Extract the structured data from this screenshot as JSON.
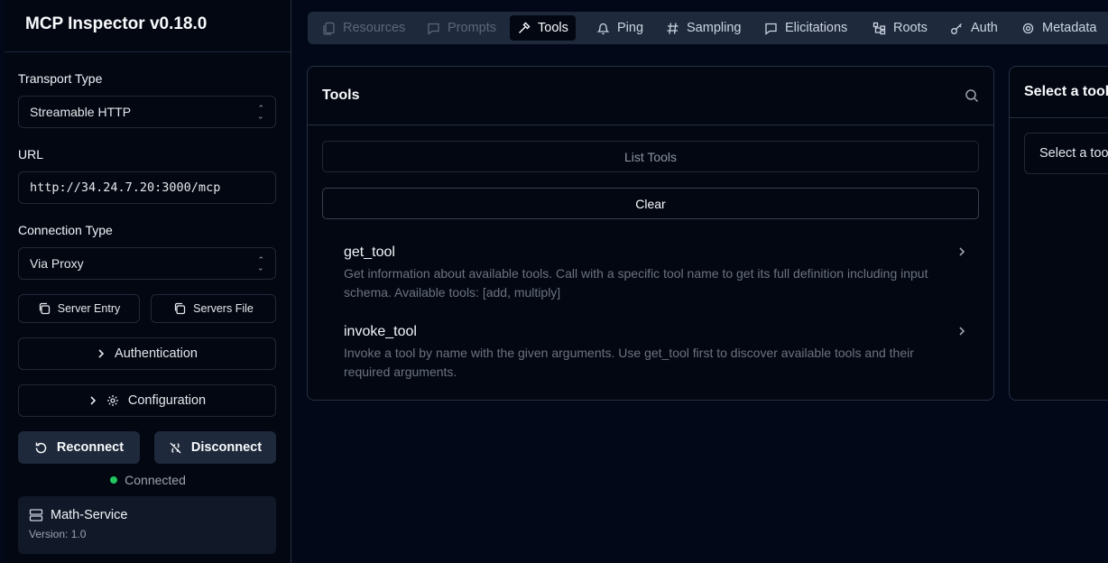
{
  "app": {
    "title": "MCP Inspector v0.18.0"
  },
  "sidebar": {
    "transport_label": "Transport Type",
    "transport_value": "Streamable HTTP",
    "url_label": "URL",
    "url_value": "http://34.24.7.20:3000/mcp",
    "connection_label": "Connection Type",
    "connection_value": "Via Proxy",
    "server_entry_label": "Server Entry",
    "servers_file_label": "Servers File",
    "authentication_label": "Authentication",
    "configuration_label": "Configuration",
    "reconnect_label": "Reconnect",
    "disconnect_label": "Disconnect",
    "status_text": "Connected",
    "server": {
      "name": "Math-Service",
      "version": "Version: 1.0"
    }
  },
  "tabs": [
    {
      "label": "Resources",
      "icon": "files-icon",
      "state": "disabled"
    },
    {
      "label": "Prompts",
      "icon": "message-icon",
      "state": "disabled"
    },
    {
      "label": "Tools",
      "icon": "hammer-icon",
      "state": "active"
    },
    {
      "label": "Ping",
      "icon": "bell-icon",
      "state": "normal"
    },
    {
      "label": "Sampling",
      "icon": "hash-icon",
      "state": "normal"
    },
    {
      "label": "Elicitations",
      "icon": "message-icon",
      "state": "normal"
    },
    {
      "label": "Roots",
      "icon": "folder-tree-icon",
      "state": "normal"
    },
    {
      "label": "Auth",
      "icon": "key-icon",
      "state": "normal"
    },
    {
      "label": "Metadata",
      "icon": "gear-icon",
      "state": "normal"
    }
  ],
  "tools_panel": {
    "title": "Tools",
    "list_button": "List Tools",
    "clear_button": "Clear",
    "items": [
      {
        "name": "get_tool",
        "description": "Get information about available tools. Call with a specific tool name to get its full definition including input schema. Available tools: [add, multiply]"
      },
      {
        "name": "invoke_tool",
        "description": "Invoke a tool by name with the given arguments. Use get_tool first to discover available tools and their required arguments."
      }
    ]
  },
  "detail_panel": {
    "title": "Select a tool",
    "select_text": "Select a tool"
  },
  "colors": {
    "background": "#020817",
    "status_green": "#22c55e",
    "tab_bar": "#1e293b"
  }
}
